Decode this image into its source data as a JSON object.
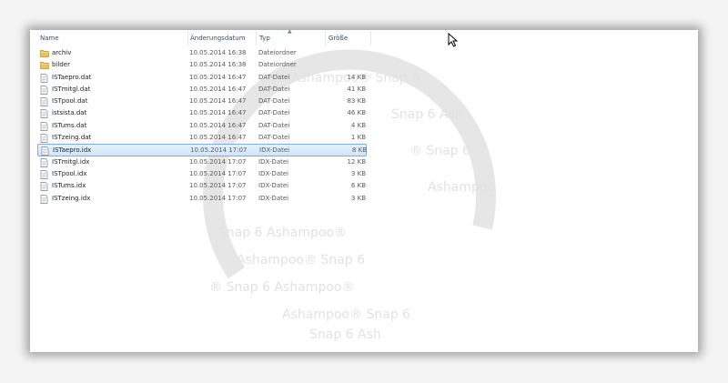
{
  "columns": {
    "name": "Name",
    "date": "Änderungsdatum",
    "type": "Typ",
    "size": "Größe"
  },
  "files": [
    {
      "name": "archiv",
      "date": "10.05.2014 16:38",
      "type": "Dateiordner",
      "size": "",
      "icon": "folder-icon",
      "selected": false
    },
    {
      "name": "bilder",
      "date": "10.05.2014 16:38",
      "type": "Dateiordner",
      "size": "",
      "icon": "folder-icon",
      "selected": false
    },
    {
      "name": "ISTaepro.dat",
      "date": "10.05.2014 16:47",
      "type": "DAT-Datei",
      "size": "14 KB",
      "icon": "file-icon",
      "selected": false
    },
    {
      "name": "ISTmitgl.dat",
      "date": "10.05.2014 16:47",
      "type": "DAT-Datei",
      "size": "41 KB",
      "icon": "file-icon",
      "selected": false
    },
    {
      "name": "ISTpool.dat",
      "date": "10.05.2014 16:47",
      "type": "DAT-Datei",
      "size": "83 KB",
      "icon": "file-icon",
      "selected": false
    },
    {
      "name": "istsista.dat",
      "date": "10.05.2014 16:47",
      "type": "DAT-Datei",
      "size": "46 KB",
      "icon": "file-icon",
      "selected": false
    },
    {
      "name": "ISTums.dat",
      "date": "10.05.2014 16:47",
      "type": "DAT-Datei",
      "size": "4 KB",
      "icon": "file-icon",
      "selected": false
    },
    {
      "name": "ISTzeing.dat",
      "date": "10.05.2014 16:47",
      "type": "DAT-Datei",
      "size": "1 KB",
      "icon": "file-icon",
      "selected": false
    },
    {
      "name": "ISTaepro.idx",
      "date": "10.05.2014 17:07",
      "type": "IDX-Datei",
      "size": "8 KB",
      "icon": "file-icon",
      "selected": true
    },
    {
      "name": "ISTmitgl.idx",
      "date": "10.05.2014 17:07",
      "type": "IDX-Datei",
      "size": "12 KB",
      "icon": "file-icon",
      "selected": false
    },
    {
      "name": "ISTpool.idx",
      "date": "10.05.2014 17:07",
      "type": "IDX-Datei",
      "size": "3 KB",
      "icon": "file-icon",
      "selected": false
    },
    {
      "name": "ISTums.idx",
      "date": "10.05.2014 17:07",
      "type": "IDX-Datei",
      "size": "6 KB",
      "icon": "file-icon",
      "selected": false
    },
    {
      "name": "ISTzeing.idx",
      "date": "10.05.2014 17:07",
      "type": "IDX-Datei",
      "size": "3 KB",
      "icon": "file-icon",
      "selected": false
    }
  ],
  "watermark": {
    "text": "Ashampoo® Snap 6"
  },
  "colors": {
    "selection": "#cfe5fb",
    "selection_border": "#84acdd",
    "folder": "#e8c25a",
    "header_text": "#3a4a66"
  }
}
